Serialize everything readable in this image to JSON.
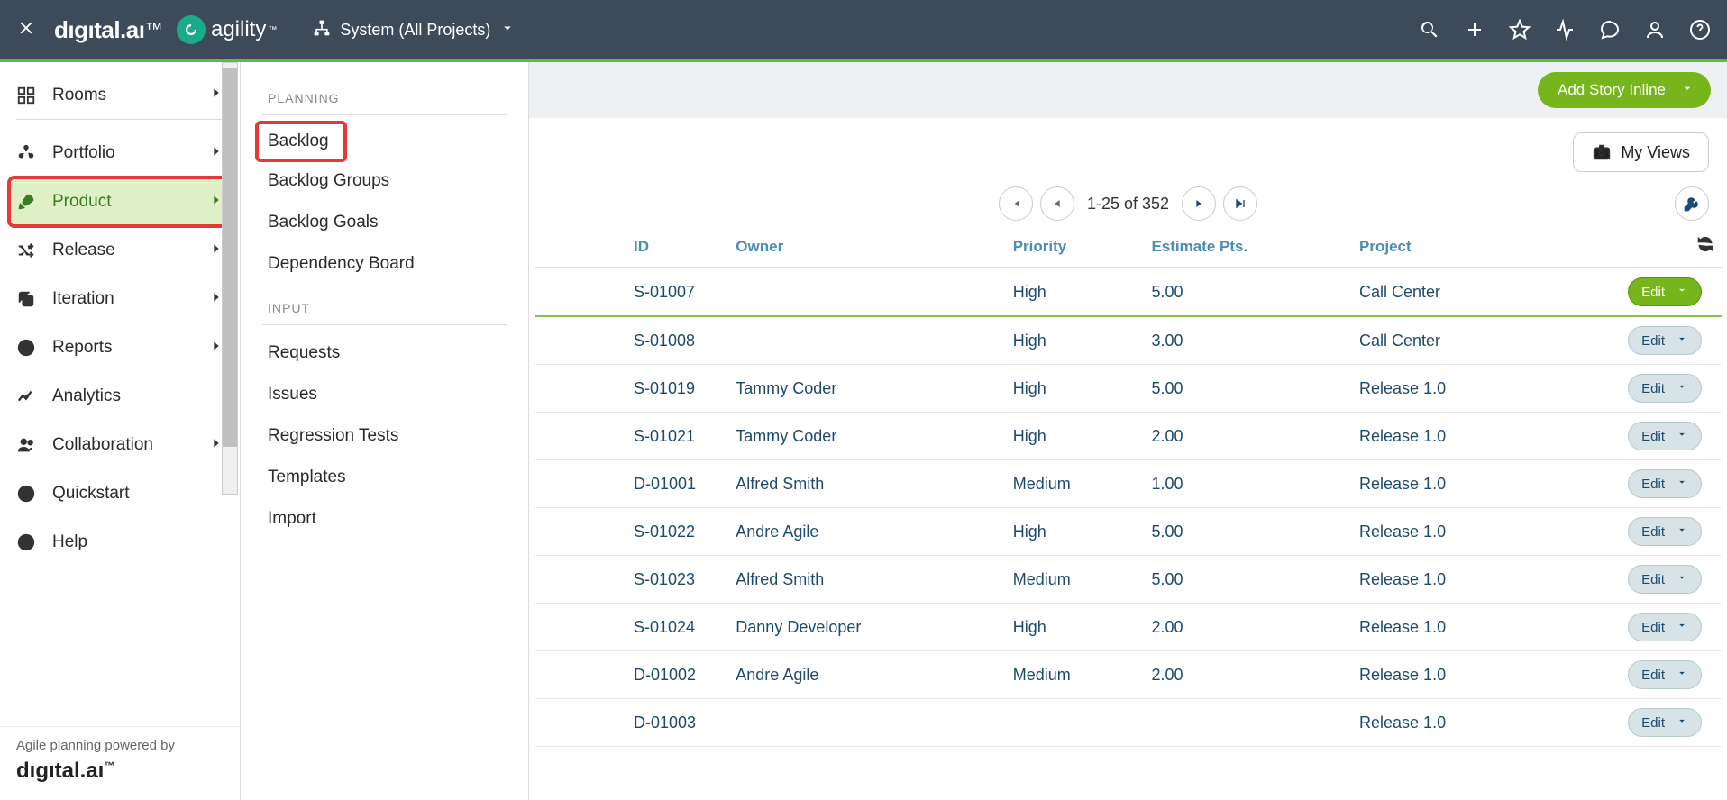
{
  "topbar": {
    "brand_primary": "dıgıtal.aı",
    "brand_secondary": "agility",
    "project_label": "System (All Projects)"
  },
  "sidebar": {
    "rooms": "Rooms",
    "items": [
      {
        "label": "Portfolio"
      },
      {
        "label": "Product"
      },
      {
        "label": "Release"
      },
      {
        "label": "Iteration"
      },
      {
        "label": "Reports"
      },
      {
        "label": "Analytics"
      },
      {
        "label": "Collaboration"
      },
      {
        "label": "Quickstart"
      },
      {
        "label": "Help"
      }
    ],
    "footer_text": "Agile planning powered by",
    "footer_logo": "dıgıtal.aı"
  },
  "secondary": {
    "planning_heading": "PLANNING",
    "planning_items": [
      "Backlog",
      "Backlog Groups",
      "Backlog Goals",
      "Dependency Board"
    ],
    "input_heading": "INPUT",
    "input_items": [
      "Requests",
      "Issues",
      "Regression Tests",
      "Templates",
      "Import"
    ]
  },
  "content": {
    "add_button": "Add Story Inline",
    "my_views": "My Views",
    "pager_text": "1-25 of 352",
    "columns": {
      "id": "ID",
      "owner": "Owner",
      "priority": "Priority",
      "estimate": "Estimate Pts.",
      "project": "Project"
    },
    "edit_label": "Edit",
    "rows": [
      {
        "id": "S-01007",
        "owner": "",
        "priority": "High",
        "estimate": "5.00",
        "project": "Call Center",
        "primary": true
      },
      {
        "id": "S-01008",
        "owner": "",
        "priority": "High",
        "estimate": "3.00",
        "project": "Call Center"
      },
      {
        "id": "S-01019",
        "owner": "Tammy Coder",
        "priority": "High",
        "estimate": "5.00",
        "project": "Release 1.0"
      },
      {
        "id": "S-01021",
        "owner": "Tammy Coder",
        "priority": "High",
        "estimate": "2.00",
        "project": "Release 1.0"
      },
      {
        "id": "D-01001",
        "owner": "Alfred Smith",
        "priority": "Medium",
        "estimate": "1.00",
        "project": "Release 1.0"
      },
      {
        "id": "S-01022",
        "owner": "Andre Agile",
        "priority": "High",
        "estimate": "5.00",
        "project": "Release 1.0"
      },
      {
        "id": "S-01023",
        "owner": "Alfred Smith",
        "priority": "Medium",
        "estimate": "5.00",
        "project": "Release 1.0"
      },
      {
        "id": "S-01024",
        "owner": "Danny Developer",
        "priority": "High",
        "estimate": "2.00",
        "project": "Release 1.0"
      },
      {
        "id": "D-01002",
        "owner": "Andre Agile",
        "priority": "Medium",
        "estimate": "2.00",
        "project": "Release 1.0"
      },
      {
        "id": "D-01003",
        "owner": "",
        "priority": "",
        "estimate": "",
        "project": "Release 1.0"
      }
    ]
  }
}
